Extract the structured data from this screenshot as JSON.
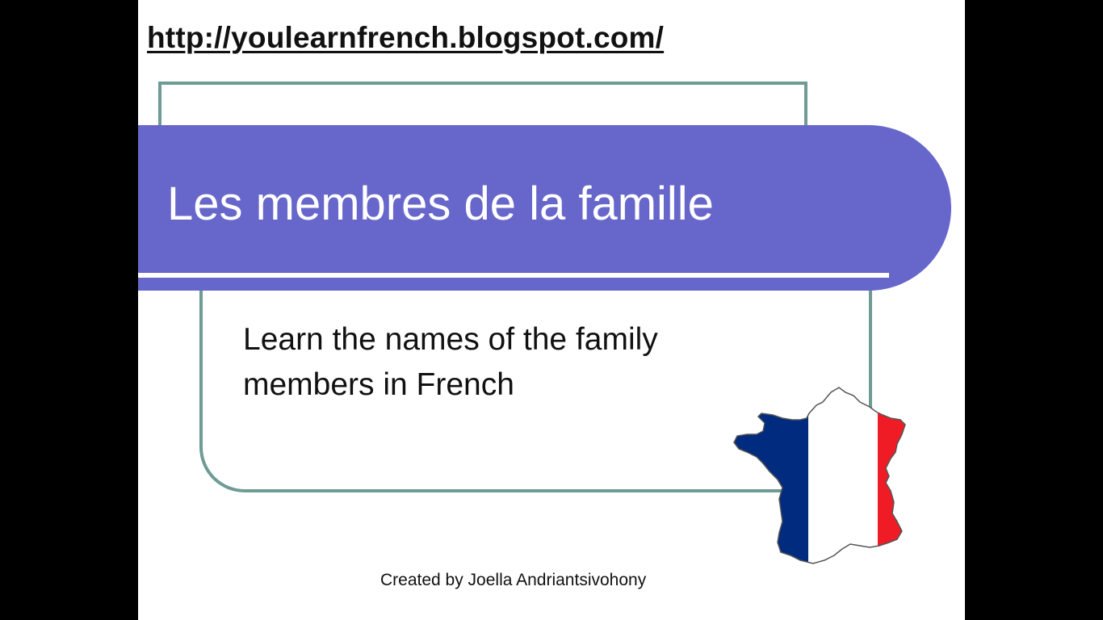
{
  "slide": {
    "url": "http://youlearnfrench.blogspot.com/",
    "title": "Les membres de la famille",
    "subtitle": "Learn the names of the family members in French",
    "credit": "Created by Joella Andriantsivohony",
    "map_icon": "france-flag-map-icon"
  },
  "colors": {
    "background": "#000000",
    "slide": "#ffffff",
    "title_band": "#6767cb",
    "frame": "#6f9b95",
    "flag_blue": "#002b7f",
    "flag_white": "#ffffff",
    "flag_red": "#ef1c25"
  }
}
